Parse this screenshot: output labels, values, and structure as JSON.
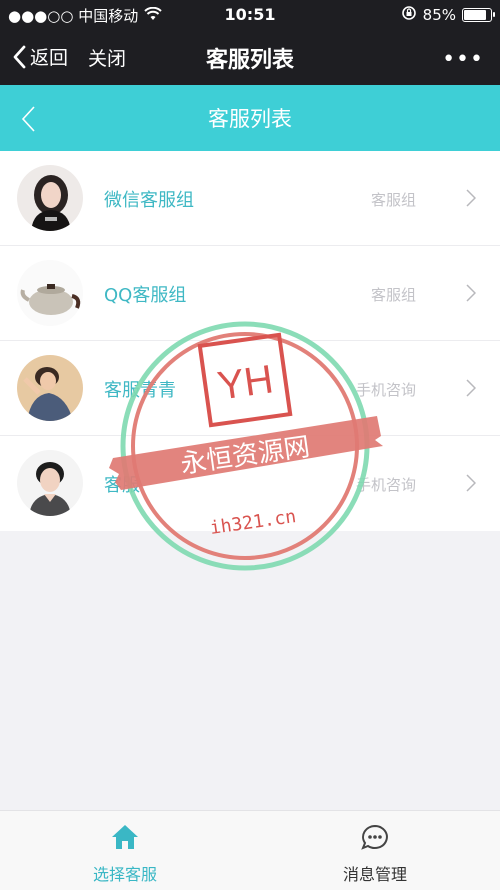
{
  "status_bar": {
    "carrier": "●●●○○ 中国移动",
    "time": "10:51",
    "battery_text": "85%",
    "battery_level": 0.85
  },
  "wechat_bar": {
    "back_label": "返回",
    "close_label": "关闭",
    "title": "客服列表",
    "more_label": "•••"
  },
  "nav": {
    "title": "客服列表"
  },
  "list": {
    "items": [
      {
        "name": "微信客服组",
        "group": "客服组",
        "avatar": "girl-portrait"
      },
      {
        "name": "QQ客服组",
        "group": "客服组",
        "avatar": "teapot"
      },
      {
        "name": "客服青青",
        "group": "手机咨询",
        "avatar": "retro-woman"
      },
      {
        "name": "客服",
        "group": "手机咨询",
        "avatar": "boy-portrait"
      }
    ]
  },
  "tabbar": {
    "tabs": [
      {
        "label": "选择客服",
        "icon": "home-icon",
        "active": true
      },
      {
        "label": "消息管理",
        "icon": "chat-bubble-icon",
        "active": false
      }
    ]
  },
  "watermark": {
    "logo": "YH",
    "banner": "永恒资源网",
    "url": "ih321.cn"
  },
  "colors": {
    "accent": "#3ecfd6",
    "accent_text": "#3fb8c4",
    "dark_bar": "#1e1e22",
    "watermark_red": "#d9534f",
    "watermark_green": "#7ed9b0"
  }
}
